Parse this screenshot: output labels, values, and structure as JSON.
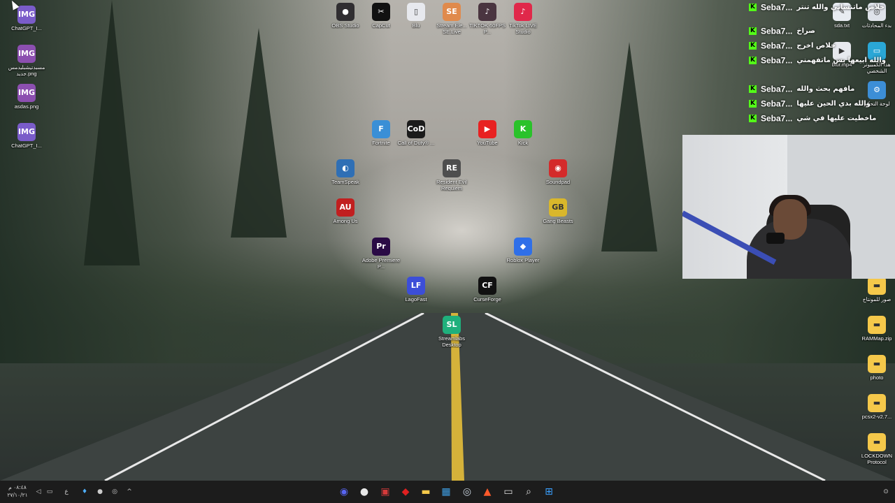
{
  "desktop": {
    "wallpaper_colors": {
      "fog": "#b6b3ad",
      "forest": "#2f3d33",
      "road": "#3b403f"
    },
    "icons": [
      {
        "label": "ChatGPT_I...",
        "glyph": "IMG",
        "color": "#7a5cc9",
        "icon": "image-file-icon"
      },
      {
        "label": "مسبدتيشبليدمس جديد.png",
        "glyph": "IMG",
        "color": "#8c4fb0",
        "icon": "image-file-icon"
      },
      {
        "label": "asdas.png",
        "glyph": "IMG",
        "color": "#8c4fb0",
        "icon": "image-file-icon"
      },
      {
        "label": "ChatGPT_I...",
        "glyph": "IMG",
        "color": "#7a5cc9",
        "icon": "image-file-icon"
      },
      {
        "label": "OBS Studio",
        "glyph": "●",
        "color": "#302e31",
        "icon": "obs-icon"
      },
      {
        "label": "CapCut",
        "glyph": "✂",
        "color": "#111111",
        "icon": "capcut-icon"
      },
      {
        "label": "Blu",
        "glyph": "▯",
        "color": "#e7e9ee",
        "icon": "file-icon"
      },
      {
        "label": "Stream Ele... SE.Live",
        "glyph": "SE",
        "color": "#e08a4c",
        "icon": "streamelements-icon"
      },
      {
        "label": "TIKTOK 60FPS P...",
        "glyph": "♪",
        "color": "#4a3540",
        "icon": "tiktok-icon"
      },
      {
        "label": "TikTok LIVE Studio",
        "glyph": "♪",
        "color": "#e0284a",
        "icon": "tiktok-live-icon"
      },
      {
        "label": "Fortnite",
        "glyph": "F",
        "color": "#3a8fd6",
        "icon": "fortnite-icon"
      },
      {
        "label": "Call of Duty® ...",
        "glyph": "CoD",
        "color": "#1b1b1b",
        "icon": "call-of-duty-icon"
      },
      {
        "label": "YouTube",
        "glyph": "▶",
        "color": "#e82121",
        "icon": "youtube-icon"
      },
      {
        "label": "Kick",
        "glyph": "K",
        "color": "#2ac22a",
        "icon": "kick-icon"
      },
      {
        "label": "TeamSpeak",
        "glyph": "◐",
        "color": "#2f6fb5",
        "icon": "teamspeak-icon"
      },
      {
        "label": "Resident Evil Requiem",
        "glyph": "RE",
        "color": "#4e4e4e",
        "icon": "resident-evil-icon"
      },
      {
        "label": "Soundpad",
        "glyph": "◉",
        "color": "#d42a2a",
        "icon": "soundpad-icon"
      },
      {
        "label": "Among Us",
        "glyph": "AU",
        "color": "#c11f1f",
        "icon": "among-us-icon"
      },
      {
        "label": "Gang Beasts",
        "glyph": "GB",
        "color": "#d9b72b",
        "icon": "gang-beasts-icon"
      },
      {
        "label": "Adobe Premiere P...",
        "glyph": "Pr",
        "color": "#2a0b45",
        "icon": "premiere-icon"
      },
      {
        "label": "Roblox Player",
        "glyph": "◆",
        "color": "#2f6fe8",
        "icon": "roblox-icon"
      },
      {
        "label": "LagoFast",
        "glyph": "LF",
        "color": "#3c4ed8",
        "icon": "lagofast-icon"
      },
      {
        "label": "CurseForge",
        "glyph": "CF",
        "color": "#111111",
        "icon": "curseforge-icon"
      },
      {
        "label": "Streamlabs Desktop",
        "glyph": "SL",
        "color": "#1fb07c",
        "icon": "streamlabs-icon"
      },
      {
        "label": "sda.txt",
        "glyph": "✎",
        "color": "#e8ecf2",
        "icon": "text-file-icon"
      },
      {
        "label": "بدء المحادثات",
        "glyph": "◎",
        "color": "#dfe3ea",
        "icon": "app-icon"
      },
      {
        "label": "blur.mp4",
        "glyph": "▶",
        "color": "#e7e9ee",
        "icon": "video-file-icon"
      },
      {
        "label": "هذا الكمبيوتر الشخصي",
        "glyph": "▭",
        "color": "#2aa7d6",
        "icon": "this-pc-icon"
      },
      {
        "label": "لوحة التحكم",
        "glyph": "⚙",
        "color": "#3c8ed6",
        "icon": "control-panel-icon"
      },
      {
        "label": "صور للمونتاج",
        "glyph": "▬",
        "color": "#f5c84a",
        "icon": "folder-icon"
      },
      {
        "label": "RAMMap.zip",
        "glyph": "▬",
        "color": "#f5c84a",
        "icon": "zip-folder-icon"
      },
      {
        "label": "photo",
        "glyph": "▬",
        "color": "#f5c84a",
        "icon": "folder-icon"
      },
      {
        "label": "pcsx2-v2.7...",
        "glyph": "▬",
        "color": "#f5c84a",
        "icon": "folder-icon"
      },
      {
        "label": "LOCKDOWN Protocol",
        "glyph": "▬",
        "color": "#f5c84a",
        "icon": "folder-icon"
      }
    ]
  },
  "chat": {
    "platform_badge": "K",
    "badge_color": "#53fc18",
    "messages": [
      {
        "user": "Seba7...",
        "text": "خلاص ماتنساني والله تنتر"
      },
      {
        "user": "Seba7...",
        "text": "صراخ"
      },
      {
        "user": "Seba7...",
        "text": "خلاص اخرج"
      },
      {
        "user": "Seba7...",
        "text": "والله ابيعها بس ماتفهمني"
      },
      {
        "user": "Seba7...",
        "text": "مافهم بحث والله"
      },
      {
        "user": "Seba7...",
        "text": "والله بدي الحين عليها"
      },
      {
        "user": "Seba7...",
        "text": "ماخطيت عليها في شي"
      }
    ]
  },
  "taskbar": {
    "clock_time": "٠٨:٤٨ م",
    "clock_date": "٢٧/١٠/٢١",
    "language": "ع",
    "tray_icons": [
      "volume-icon",
      "network-icon",
      "mic-icon",
      "obs-tray-icon",
      "streamlabs-tray-icon",
      "show-hidden-icons-icon"
    ],
    "pinned": [
      {
        "name": "discord-icon",
        "glyph": "◉",
        "color": "#5865f2"
      },
      {
        "name": "obs-taskbar-icon",
        "glyph": "●",
        "color": "#e8e8e8"
      },
      {
        "name": "streamer-app-icon",
        "glyph": "▣",
        "color": "#d43a3a"
      },
      {
        "name": "red-app-icon",
        "glyph": "◆",
        "color": "#e02020"
      },
      {
        "name": "file-explorer-icon",
        "glyph": "▬",
        "color": "#f5c84a"
      },
      {
        "name": "store-icon",
        "glyph": "▦",
        "color": "#3fa0e6"
      },
      {
        "name": "steam-icon",
        "glyph": "◎",
        "color": "#c9d3de"
      },
      {
        "name": "brave-icon",
        "glyph": "▲",
        "color": "#ff5a2b"
      },
      {
        "name": "task-view-icon",
        "glyph": "▭",
        "color": "#dddddd"
      },
      {
        "name": "search-icon",
        "glyph": "⌕",
        "color": "#dddddd"
      },
      {
        "name": "start-icon",
        "glyph": "⊞",
        "color": "#3aa0ff"
      }
    ]
  }
}
